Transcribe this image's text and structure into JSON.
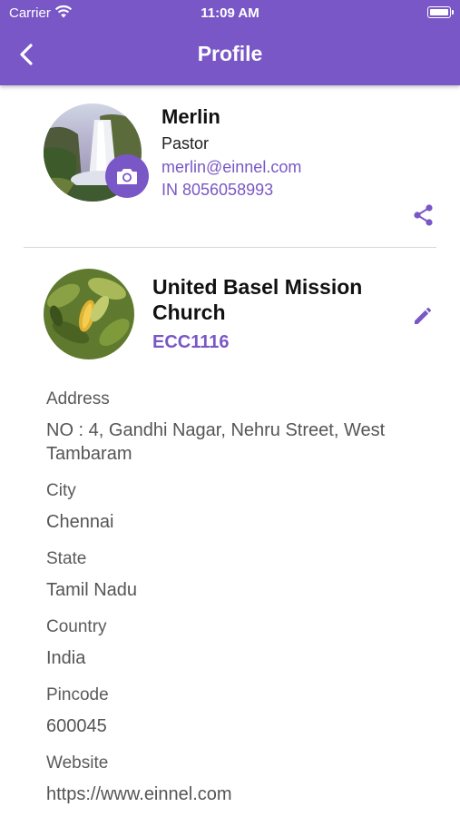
{
  "status_bar": {
    "carrier": "Carrier",
    "time": "11:09 AM"
  },
  "header": {
    "title": "Profile"
  },
  "user": {
    "name": "Merlin",
    "role": "Pastor",
    "email": "merlin@einnel.com",
    "phone": "IN 8056058993"
  },
  "church": {
    "name": "United Basel Mission Church",
    "code": "ECC1116",
    "fields": [
      {
        "label": "Address",
        "value": "NO : 4, Gandhi Nagar, Nehru Street, West Tambaram"
      },
      {
        "label": "City",
        "value": "Chennai"
      },
      {
        "label": "State",
        "value": "Tamil Nadu"
      },
      {
        "label": "Country",
        "value": "India"
      },
      {
        "label": "Pincode",
        "value": "600045"
      },
      {
        "label": "Website",
        "value": "https://www.einnel.com"
      }
    ]
  },
  "icons": {
    "back": "chevron-left-icon",
    "camera": "camera-icon",
    "share": "share-icon",
    "edit": "pencil-icon",
    "wifi": "wifi-icon",
    "battery": "battery-icon"
  },
  "colors": {
    "accent": "#7a57c6",
    "header_bg": "#7a57c6"
  }
}
